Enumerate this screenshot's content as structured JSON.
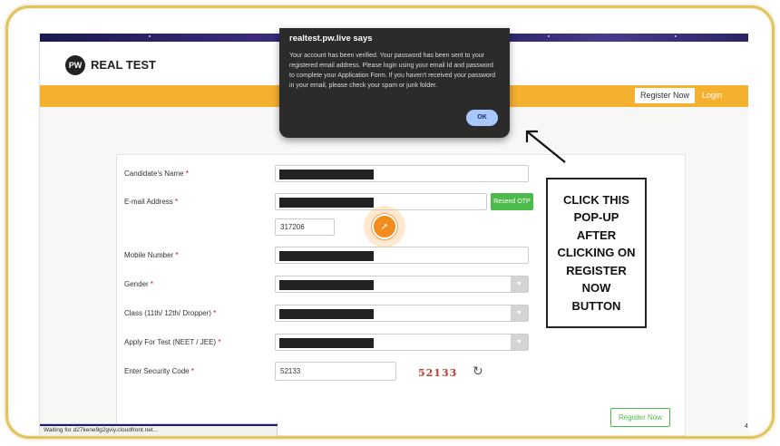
{
  "site": {
    "brand": "REAL TEST",
    "logo_text": "PW",
    "nav": {
      "register_label": "Register Now",
      "login_label": "Login"
    },
    "colors": {
      "nav_bar": "#f4b02f",
      "accent_green": "#4cbb4c",
      "captcha_red": "#c0392b"
    }
  },
  "dialog": {
    "title": "realtest.pw.live says",
    "message": "Your account has been verified. Your password has been sent to your registered email address. Please login using your email Id and password to complete your Application Form. If you haven't received your password in your email, please check your spam or junk folder.",
    "ok_label": "OK"
  },
  "form": {
    "fields": [
      {
        "label": "Candidate's Name",
        "req": "*",
        "type": "text",
        "redacted": true
      },
      {
        "label": "E-mail Address",
        "req": "*",
        "type": "text",
        "redacted": true
      },
      {
        "label": "Mobile Number",
        "req": "*",
        "type": "text",
        "redacted": true
      },
      {
        "label": "Gender",
        "req": "*",
        "type": "select",
        "redacted": true
      },
      {
        "label": "Class (11th/ 12th/ Dropper)",
        "req": "*",
        "type": "select",
        "redacted": true
      },
      {
        "label": "Apply For Test (NEET / JEE)",
        "req": "*",
        "type": "select",
        "redacted": true
      },
      {
        "label": "Enter Security Code",
        "req": "*",
        "type": "text"
      }
    ],
    "resend_otp_label": "Resend OTP",
    "otp_value": "317206",
    "security_code_value": "52133",
    "captcha_text": "52133",
    "refresh_icon": "refresh-icon",
    "submit_label": "Register Now"
  },
  "status_bar": {
    "text": "Waiting for d27kene9g2gviy.cloudfront.net..."
  },
  "annotation": {
    "text": "CLICK THIS\nPOP-UP\nAFTER\nCLICKING ON\nREGISTER\nNOW\nBUTTON"
  },
  "corner_mark": "4"
}
